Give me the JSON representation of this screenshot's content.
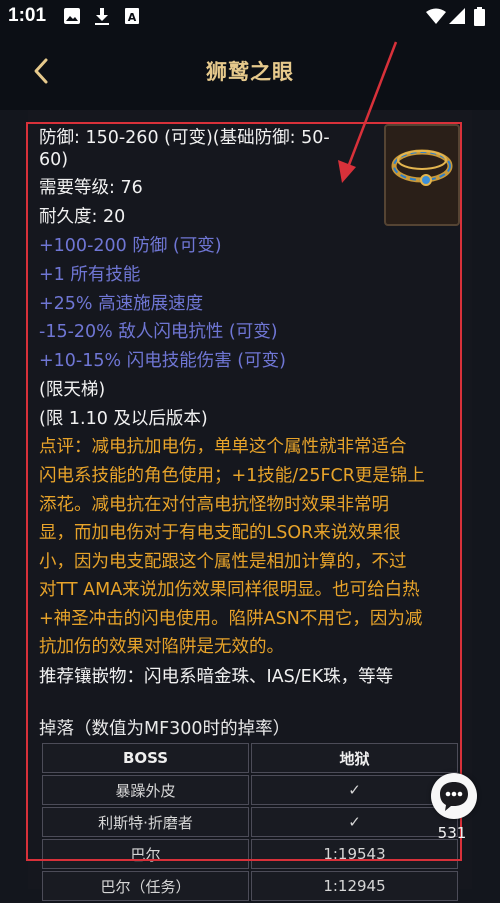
{
  "status_bar": {
    "time": "1:01",
    "icons": [
      "image-icon",
      "download-icon",
      "text-icon",
      "wifi-icon",
      "signal-icon",
      "battery-icon"
    ]
  },
  "app_bar": {
    "title": "狮鹫之眼",
    "back_icon": "chevron-left-icon"
  },
  "item": {
    "thumbnail_icon": "circlet-icon",
    "lines": [
      {
        "text": "防御: 150-260 (可变)(基础防御: 50-",
        "color": "white"
      },
      {
        "text": "60)",
        "color": "white"
      },
      {
        "text": "需要等级: 76",
        "color": "white"
      },
      {
        "text": "耐久度: 20",
        "color": "white"
      },
      {
        "text": "+100-200 防御 (可变)",
        "color": "blue"
      },
      {
        "text": "+1 所有技能",
        "color": "blue"
      },
      {
        "text": "+25% 高速施展速度",
        "color": "blue"
      },
      {
        "text": "-15-20% 敌人闪电抗性 (可变)",
        "color": "blue"
      },
      {
        "text": "+10-15% 闪电技能伤害 (可变)",
        "color": "blue"
      },
      {
        "text": "(限天梯)",
        "color": "white"
      },
      {
        "text": "(限 1.10 及以后版本)",
        "color": "white"
      },
      {
        "text": "点评：减电抗加电伤，单单这个属性就非常适合",
        "color": "orange"
      },
      {
        "text": "闪电系技能的角色使用；+1技能/25FCR更是锦上",
        "color": "orange"
      },
      {
        "text": "添花。减电抗在对付高电抗怪物时效果非常明",
        "color": "orange"
      },
      {
        "text": "显，而加电伤对于有电支配的LSOR来说效果很",
        "color": "orange"
      },
      {
        "text": "小，因为电支配跟这个属性是相加计算的，不过",
        "color": "orange"
      },
      {
        "text": "对TT AMA来说加伤效果同样很明显。也可给白热",
        "color": "orange"
      },
      {
        "text": "+神圣冲击的闪电使用。陷阱ASN不用它，因为减",
        "color": "orange"
      },
      {
        "text": "抗加伤的效果对陷阱是无效的。",
        "color": "orange"
      },
      {
        "text": "推荐镶嵌物：闪电系暗金珠、IAS/EK珠，等等",
        "color": "white"
      }
    ]
  },
  "drops": {
    "title": "掉落（数值为MF300时的掉率）",
    "headers": [
      "BOSS",
      "地狱"
    ],
    "rows": [
      [
        "暴躁外皮",
        "✓"
      ],
      [
        "利斯特·折磨者",
        "✓"
      ],
      [
        "巴尔",
        "1:19543"
      ],
      [
        "巴尔（任务）",
        "1:12945"
      ]
    ]
  },
  "chat": {
    "count": "531",
    "icon": "chat-bubble-icon"
  },
  "colors": {
    "title": "#e6c98c",
    "blue": "#6f76d4",
    "orange": "#e7a32a",
    "annotation": "#d8313a"
  }
}
